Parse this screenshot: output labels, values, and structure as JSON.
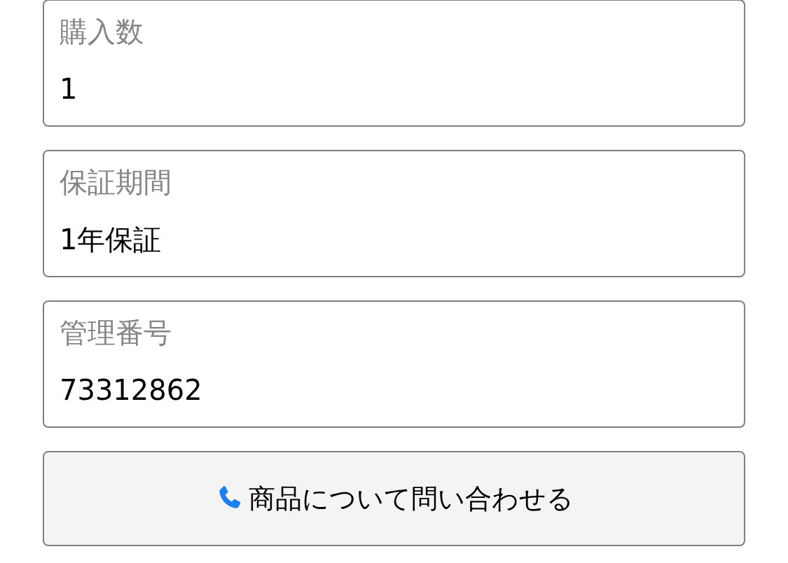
{
  "fields": [
    {
      "label": "購入数",
      "value": "1"
    },
    {
      "label": "保証期間",
      "value": "1年保証"
    },
    {
      "label": "管理番号",
      "value": "73312862"
    }
  ],
  "contact_button": {
    "label": "商品について問い合わせる"
  }
}
